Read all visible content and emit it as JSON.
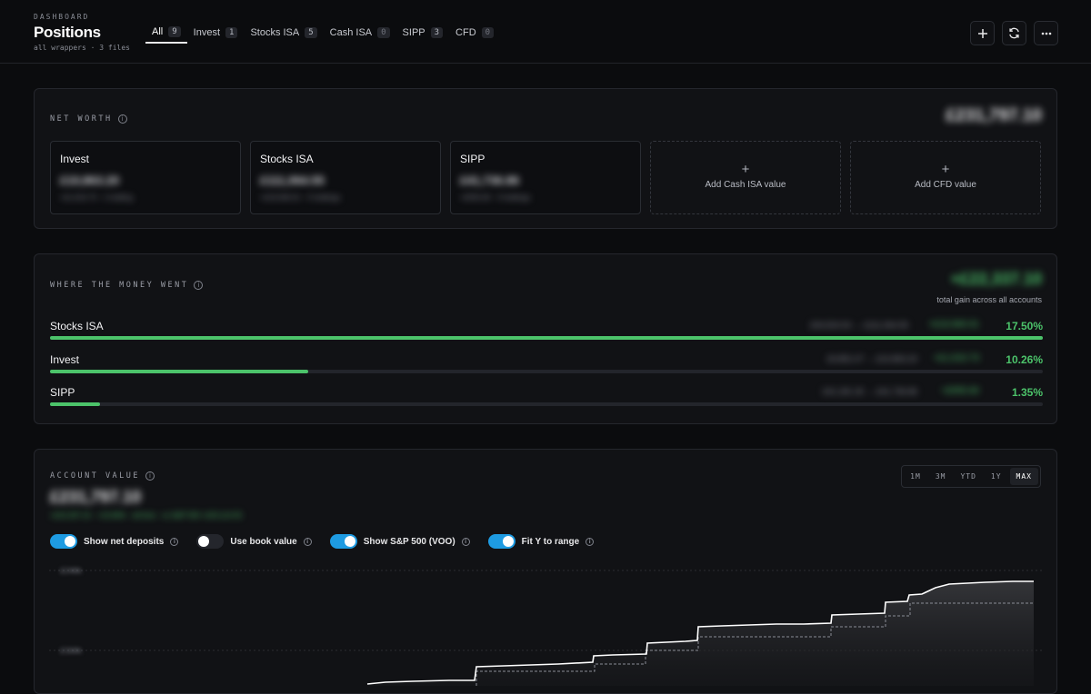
{
  "header": {
    "kicker": "DASHBOARD",
    "title": "Positions",
    "subtitle": "all wrappers · 3 files",
    "tabs": [
      {
        "label": "All",
        "count": "9",
        "active": true
      },
      {
        "label": "Invest",
        "count": "1"
      },
      {
        "label": "Stocks ISA",
        "count": "5"
      },
      {
        "label": "Cash ISA",
        "count": "0"
      },
      {
        "label": "SIPP",
        "count": "3"
      },
      {
        "label": "CFD",
        "count": "0"
      }
    ],
    "buttons": {
      "add": "+",
      "refresh": "refresh-icon",
      "more": "more-icon"
    }
  },
  "net_worth": {
    "title": "NET WORTH",
    "total": "£231,797.10",
    "cards": [
      {
        "name": "Invest",
        "value": "£10,863.20",
        "sub": "+£1,010.73 · 1 holding"
      },
      {
        "name": "Stocks ISA",
        "value": "£111,064.55",
        "sub": "+£16,560.01 · 5 holdings"
      },
      {
        "name": "SIPP",
        "value": "£41,736.86",
        "sub": "+£555.60 · 3 holdings"
      }
    ],
    "add_cards": [
      {
        "label": "Add Cash ISA value",
        "icon": "+"
      },
      {
        "label": "Add CFD value",
        "icon": "+"
      }
    ]
  },
  "money_went": {
    "title": "WHERE THE MONEY WENT",
    "total": "+£22,337.10",
    "total_sub": "total gain across all accounts",
    "rows": [
      {
        "name": "Stocks ISA",
        "detail": "£94,504.54 → £111,064.55",
        "gain": "+£16,560.01",
        "pct": "17.50%",
        "fill": 1.0
      },
      {
        "name": "Invest",
        "detail": "£9,852.47 → £10,863.20",
        "gain": "+£1,010.73",
        "pct": "10.26%",
        "fill": 0.26
      },
      {
        "name": "SIPP",
        "detail": "£41,181.26 → £41,736.86",
        "gain": "+£555.60",
        "pct": "1.35%",
        "fill": 0.05
      }
    ]
  },
  "account_value": {
    "title": "ACCOUNT VALUE",
    "value": "£231,797.10",
    "sub": "+£22,337.10 · +10.66% · all time · vs S&P 500 +£20,114.55",
    "ranges": [
      {
        "label": "1M"
      },
      {
        "label": "3M"
      },
      {
        "label": "YTD"
      },
      {
        "label": "1Y"
      },
      {
        "label": "MAX",
        "active": true
      }
    ],
    "toggles": [
      {
        "label": "Show net deposits",
        "on": true
      },
      {
        "label": "Use book value",
        "on": false
      },
      {
        "label": "Show S&P 500 (VOO)",
        "on": true
      },
      {
        "label": "Fit Y to range",
        "on": true
      }
    ],
    "y_ticks": [
      "£240k",
      "£160k"
    ],
    "colors": {
      "accent": "#1e9be2",
      "gain": "#4cc36a"
    }
  }
}
